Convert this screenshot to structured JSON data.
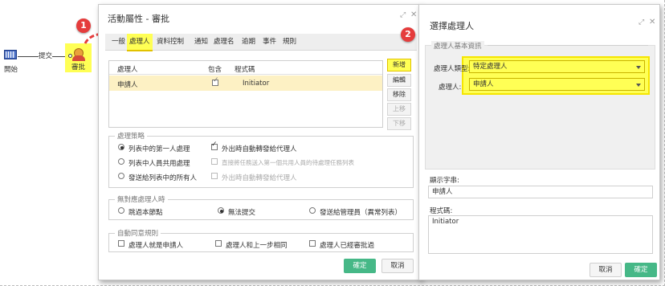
{
  "workflow": {
    "start_label": "開始",
    "edge_label": "提交",
    "approve_label": "審批"
  },
  "dialog1": {
    "title": "活動屬性 - 審批",
    "tabs": [
      "一般",
      "處理人",
      "資料控制",
      "通知",
      "處理名",
      "逾期",
      "事件",
      "規則"
    ],
    "active_tab": "處理人",
    "table": {
      "headers": [
        "處理人",
        "包含",
        "程式碼"
      ],
      "rows": [
        {
          "name": "申請人",
          "included": true,
          "code": "Initiator"
        }
      ]
    },
    "side_buttons": {
      "add": "新增",
      "edit": "編輯",
      "remove": "移除",
      "up": "上移",
      "down": "下移"
    },
    "strategy": {
      "legend": "處理策略",
      "options": [
        "列表中的第一人處理",
        "列表中人員共用處理",
        "發送給列表中的所有人"
      ],
      "checks": [
        "外出時自動轉發給代理人",
        "直接將任務送入第一個共用人員的待處理任務列表",
        "外出時自動轉發給代理人"
      ]
    },
    "no_handler": {
      "legend": "無對應處理人時",
      "options": [
        "跳過本節點",
        "無法提交",
        "發送給管理員（異常列表）"
      ]
    },
    "auto_approve": {
      "legend": "自動同意規則",
      "options": [
        "處理人就是申請人",
        "處理人和上一步相同",
        "處理人已經審批過"
      ]
    },
    "ok_label": "確定",
    "cancel_label": "取消"
  },
  "dialog2": {
    "title": "選擇處理人",
    "section_legend": "處理人基本資訊",
    "type_label": "處理人類型:",
    "type_value": "特定處理人",
    "handler_label": "處理人:",
    "handler_value": "申請人",
    "display_label": "顯示字串:",
    "display_value": "申請人",
    "code_label": "程式碼:",
    "code_value": "Initiator",
    "cancel_label": "取消",
    "ok_label": "確定"
  },
  "badges": [
    "1",
    "2"
  ],
  "colors": {
    "highlight": "#ffff55",
    "ok_button": "#46b887",
    "badge": "#e53c3c",
    "arrow": "#e53c3c"
  }
}
